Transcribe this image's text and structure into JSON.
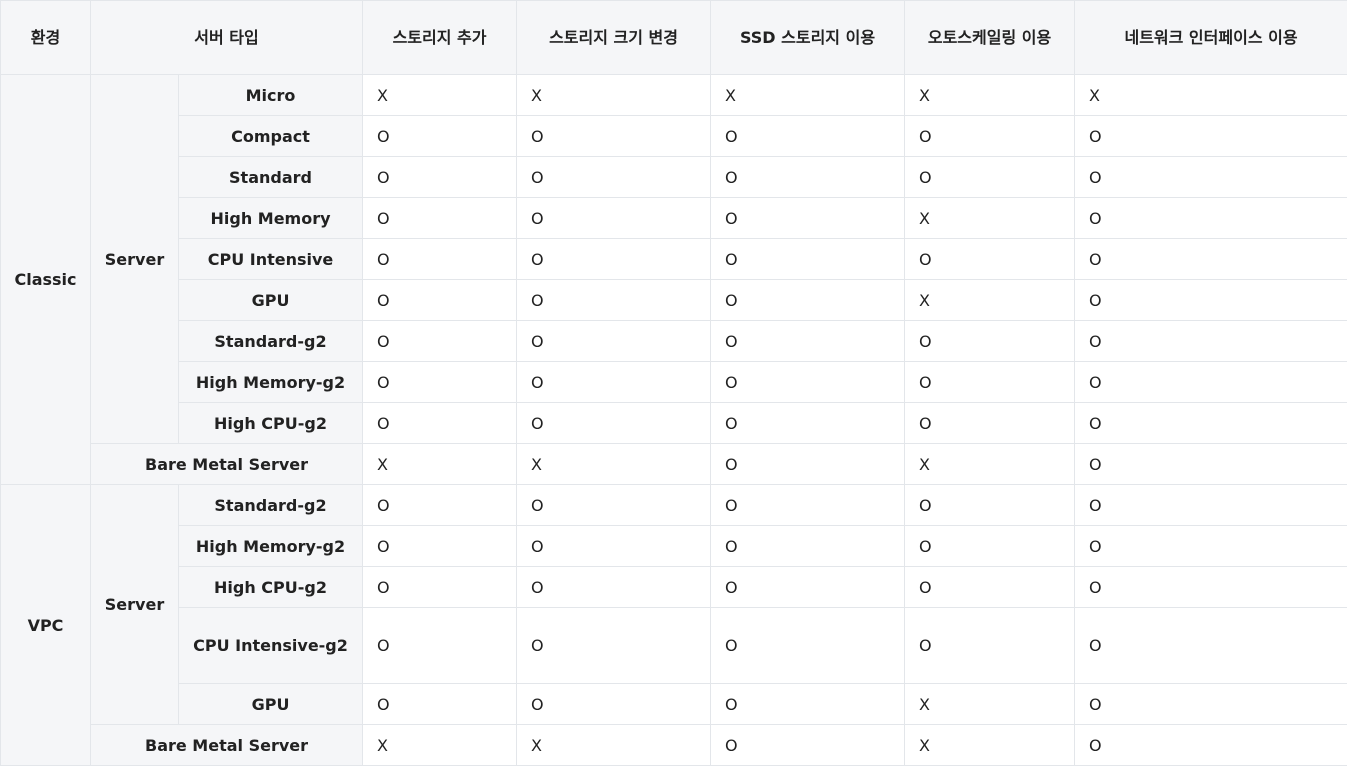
{
  "headers": {
    "env": "환경",
    "server_type": "서버 타입",
    "cols": [
      "스토리지 추가",
      "스토리지 크기 변경",
      "SSD 스토리지 이용",
      "오토스케일링 이용",
      "네트워크 인터페이스 이용"
    ]
  },
  "groups": {
    "classic": "Classic",
    "vpc": "VPC",
    "server": "Server"
  },
  "classic_rows": [
    {
      "type": "Micro",
      "vals": [
        "X",
        "X",
        "X",
        "X",
        "X"
      ]
    },
    {
      "type": "Compact",
      "vals": [
        "O",
        "O",
        "O",
        "O",
        "O"
      ]
    },
    {
      "type": "Standard",
      "vals": [
        "O",
        "O",
        "O",
        "O",
        "O"
      ]
    },
    {
      "type": "High Memory",
      "vals": [
        "O",
        "O",
        "O",
        "X",
        "O"
      ]
    },
    {
      "type": "CPU Intensive",
      "vals": [
        "O",
        "O",
        "O",
        "O",
        "O"
      ]
    },
    {
      "type": "GPU",
      "vals": [
        "O",
        "O",
        "O",
        "X",
        "O"
      ]
    },
    {
      "type": "Standard-g2",
      "vals": [
        "O",
        "O",
        "O",
        "O",
        "O"
      ]
    },
    {
      "type": "High Memory-g2",
      "vals": [
        "O",
        "O",
        "O",
        "O",
        "O"
      ]
    },
    {
      "type": "High CPU-g2",
      "vals": [
        "O",
        "O",
        "O",
        "O",
        "O"
      ]
    }
  ],
  "classic_bare": {
    "type": "Bare Metal Server",
    "vals": [
      "X",
      "X",
      "O",
      "X",
      "O"
    ]
  },
  "vpc_rows": [
    {
      "type": "Standard-g2",
      "vals": [
        "O",
        "O",
        "O",
        "O",
        "O"
      ]
    },
    {
      "type": "High Memory-g2",
      "vals": [
        "O",
        "O",
        "O",
        "O",
        "O"
      ]
    },
    {
      "type": "High CPU-g2",
      "vals": [
        "O",
        "O",
        "O",
        "O",
        "O"
      ]
    },
    {
      "type": "CPU Intensive-g2",
      "vals": [
        "O",
        "O",
        "O",
        "O",
        "O"
      ]
    },
    {
      "type": "GPU",
      "vals": [
        "O",
        "O",
        "O",
        "X",
        "O"
      ]
    }
  ],
  "vpc_bare": {
    "type": "Bare Metal Server",
    "vals": [
      "X",
      "X",
      "O",
      "X",
      "O"
    ]
  }
}
